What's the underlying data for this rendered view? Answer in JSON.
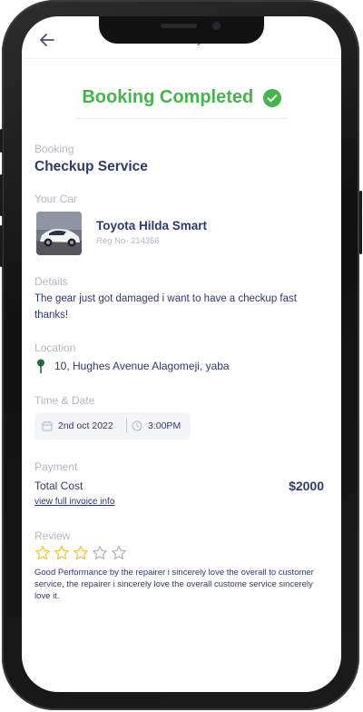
{
  "header": {
    "title": "History"
  },
  "status": {
    "text": "Booking Completed",
    "color": "#43b54a"
  },
  "booking": {
    "label": "Booking",
    "service": "Checkup Service"
  },
  "car": {
    "label": "Your Car",
    "name": "Toyota Hilda Smart",
    "reg": "Reg No- 214356"
  },
  "details": {
    "label": "Details",
    "text": "The gear just got damaged i want to have a checkup fast thanks!"
  },
  "location": {
    "label": "Location",
    "text": "10, Hughes Avenue Alagomeji, yaba"
  },
  "datetime": {
    "label": "Time & Date",
    "date": "2nd oct 2022",
    "time": "3:00PM"
  },
  "payment": {
    "label": "Payment",
    "total_label": "Total Cost",
    "total_value": "$2000",
    "invoice_link": "view full invoice info"
  },
  "review": {
    "label": "Review",
    "rating": 3,
    "max_rating": 5,
    "star_color": "#f5c542",
    "text": "Good Performance by the repairer i sincerely love the overall to customer service, the repairer i sincerely love the overall custome service sincerely love it."
  },
  "colors": {
    "primary_text": "#2f3a6b",
    "muted_label": "#b4b7c4"
  }
}
